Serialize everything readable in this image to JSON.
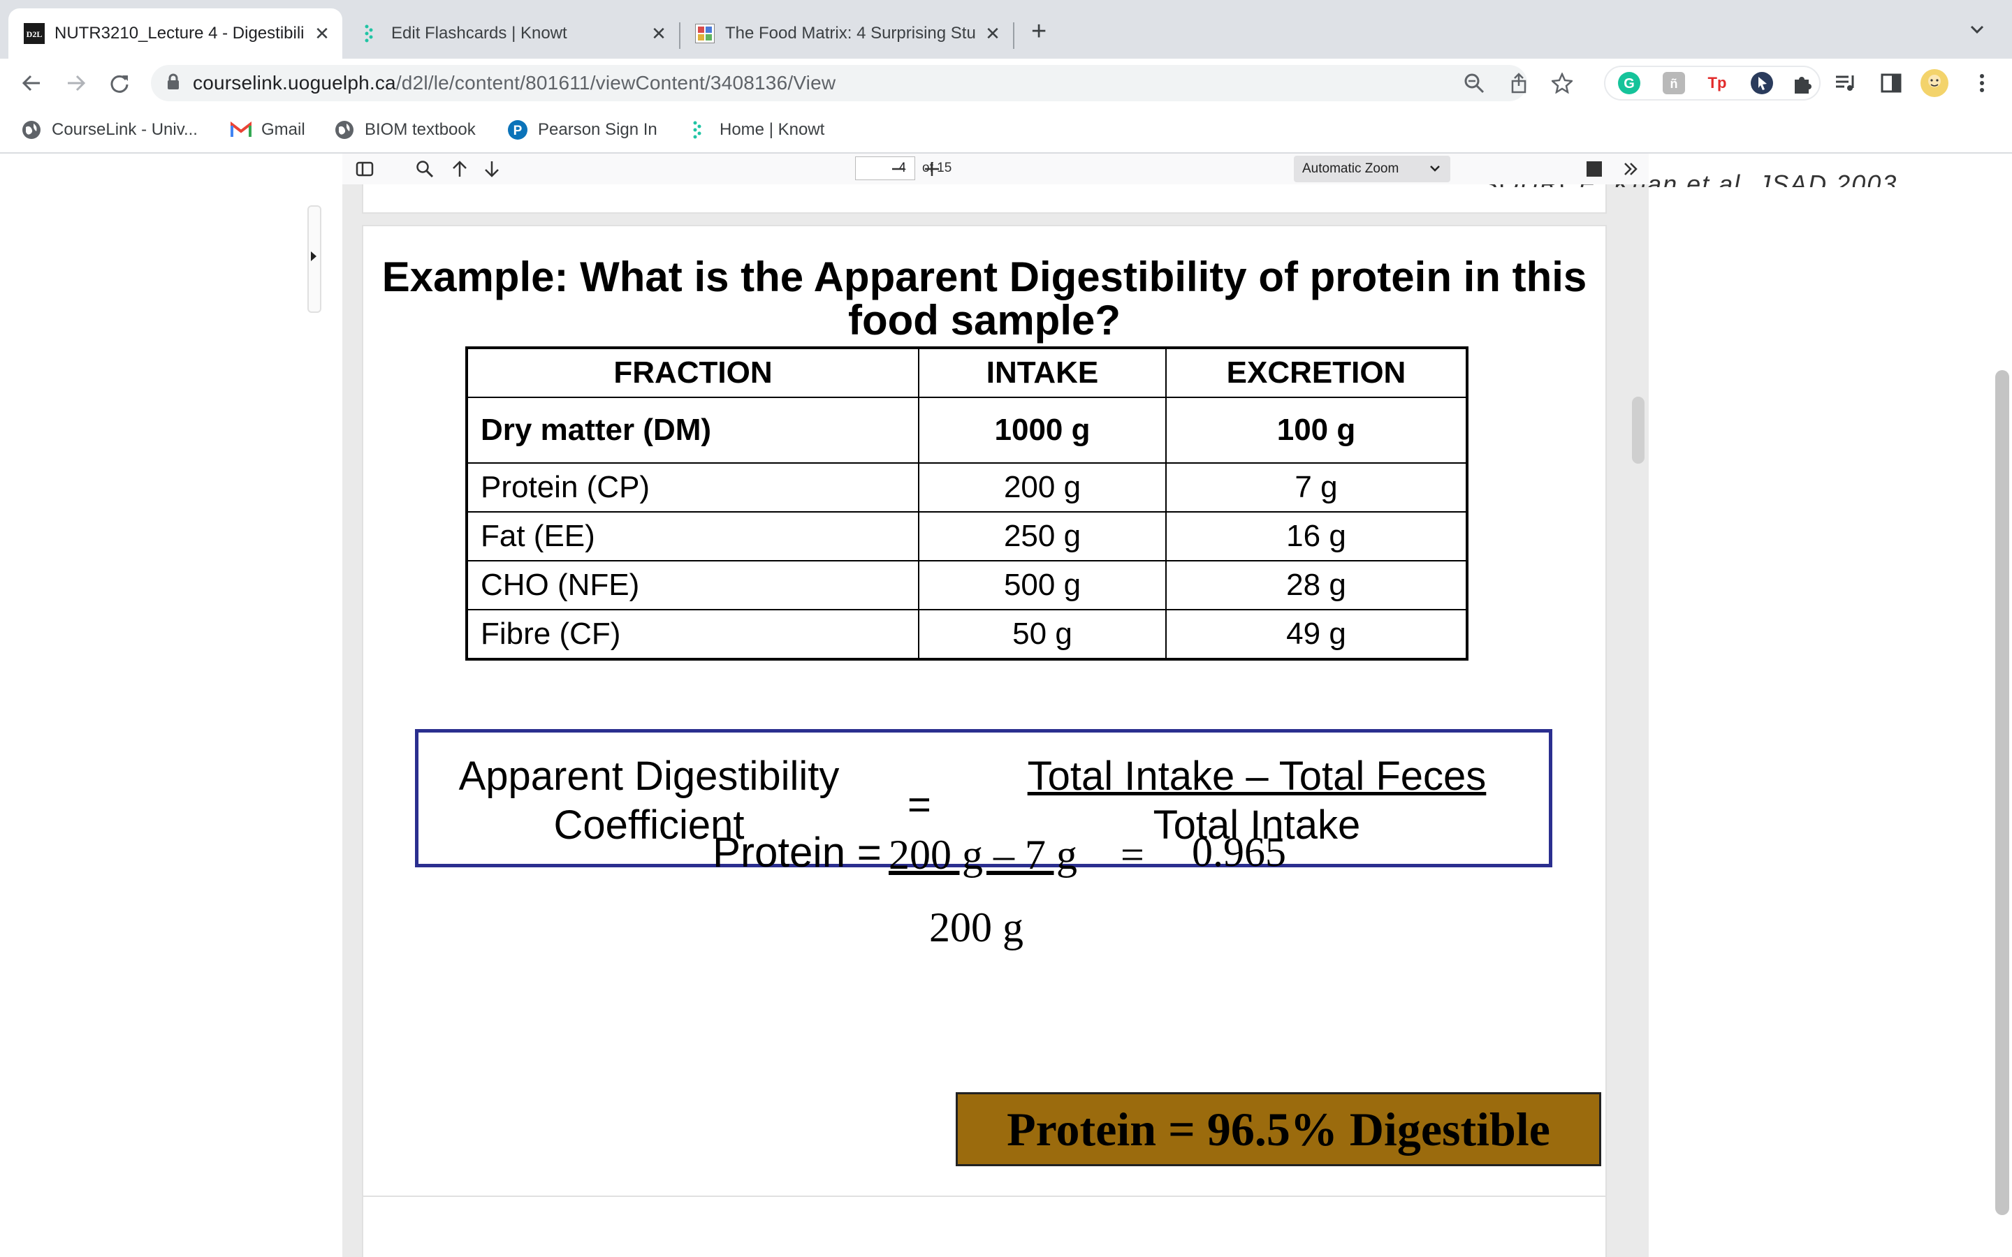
{
  "browser": {
    "tabs": [
      {
        "title": "NUTR3210_Lecture 4 - Digestibili",
        "favicon": "d2l-icon",
        "active": true
      },
      {
        "title": "Edit Flashcards | Knowt",
        "favicon": "knowt-icon",
        "active": false
      },
      {
        "title": "The Food Matrix: 4 Surprising Stu",
        "favicon": "site-icon",
        "active": false
      }
    ],
    "url_host": "courselink.uoguelph.ca",
    "url_path": "/d2l/le/content/801611/viewContent/3408136/View",
    "bookmarks": [
      {
        "label": "CourseLink - Univ...",
        "icon": "globe-icon"
      },
      {
        "label": "Gmail",
        "icon": "gmail-icon"
      },
      {
        "label": "BIOM textbook",
        "icon": "globe-icon"
      },
      {
        "label": "Pearson Sign In",
        "icon": "pearson-icon"
      },
      {
        "label": "Home | Knowt",
        "icon": "knowt-icon"
      }
    ],
    "extensions": {
      "tp": "Tp"
    }
  },
  "pdf_viewer": {
    "page_number": "4",
    "page_count": "of 15",
    "zoom": "Automatic Zoom",
    "prev_page_fragment": "SOURCE: Khan et al, JSAD 2003"
  },
  "slide": {
    "title": "Example: What is the Apparent Digestibility of protein in this food sample?",
    "table": {
      "headers": [
        "FRACTION",
        "INTAKE",
        "EXCRETION"
      ],
      "dm_row": {
        "fraction": "Dry matter (DM)",
        "intake": "1000 g",
        "excretion": "100 g"
      },
      "rows": [
        {
          "fraction": "Protein (CP)",
          "intake": "200 g",
          "excretion": "7 g"
        },
        {
          "fraction": "Fat (EE)",
          "intake": "250 g",
          "excretion": "16 g"
        },
        {
          "fraction": "CHO (NFE)",
          "intake": "500 g",
          "excretion": "28 g"
        },
        {
          "fraction": "Fibre (CF)",
          "intake": "50 g",
          "excretion": "49 g"
        }
      ]
    },
    "formula": {
      "left_line1": "Apparent Digestibility",
      "left_line2": "Coefficient",
      "equals": "=",
      "numerator": "Total Intake – Total Feces",
      "denominator": "Total Intake"
    },
    "calculation": {
      "label": "Protein =",
      "numerator": "200 g – 7 g",
      "equals": "=",
      "result": "0.965",
      "denominator": "200 g"
    },
    "result_banner": "Protein = 96.5% Digestible"
  }
}
